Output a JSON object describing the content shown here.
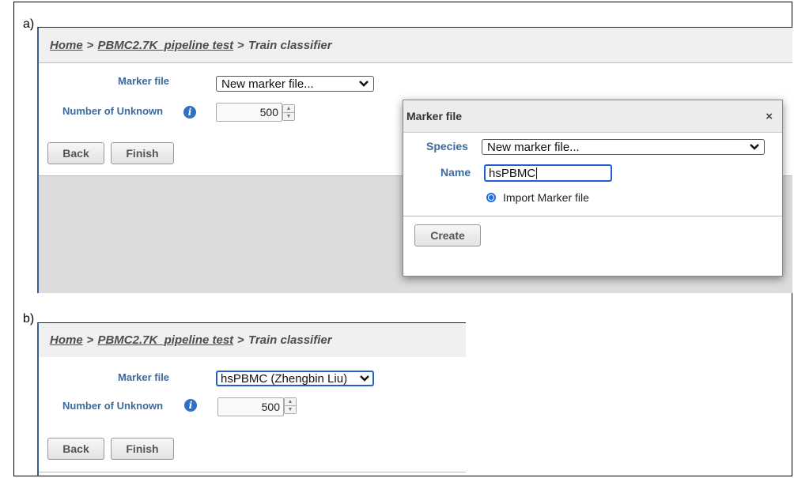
{
  "panel_a": {
    "label": "a)",
    "breadcrumb": {
      "home": "Home",
      "sep1": ">",
      "pipeline": "PBMC2.7K_pipeline test",
      "sep2": ">",
      "current": "Train classifier"
    },
    "form": {
      "marker_file_label": "Marker file",
      "marker_file_value": "New marker file...",
      "unknown_label": "Number of Unknown",
      "unknown_value": "500"
    },
    "buttons": {
      "back": "Back",
      "finish": "Finish"
    },
    "modal": {
      "title": "Marker file",
      "close_glyph": "×",
      "species_label": "Species",
      "species_value": "New marker file...",
      "name_label": "Name",
      "name_value": "hsPBMC",
      "radio_label": "Import Marker file",
      "create_label": "Create"
    }
  },
  "panel_b": {
    "label": "b)",
    "breadcrumb": {
      "home": "Home",
      "sep1": ">",
      "pipeline": "PBMC2.7K_pipeline test",
      "sep2": ">",
      "current": "Train classifier"
    },
    "form": {
      "marker_file_label": "Marker file",
      "marker_file_value": "hsPBMC (Zhengbin Liu)",
      "unknown_label": "Number of Unknown",
      "unknown_value": "500"
    },
    "buttons": {
      "back": "Back",
      "finish": "Finish"
    }
  },
  "icons": {
    "info": "i",
    "chevron": "❯",
    "spin_up": "▲",
    "spin_down": "▼"
  },
  "colors": {
    "label_blue": "#3c6a9e",
    "focus_blue": "#1f5fcf",
    "info_blue": "#2f6fc4"
  }
}
